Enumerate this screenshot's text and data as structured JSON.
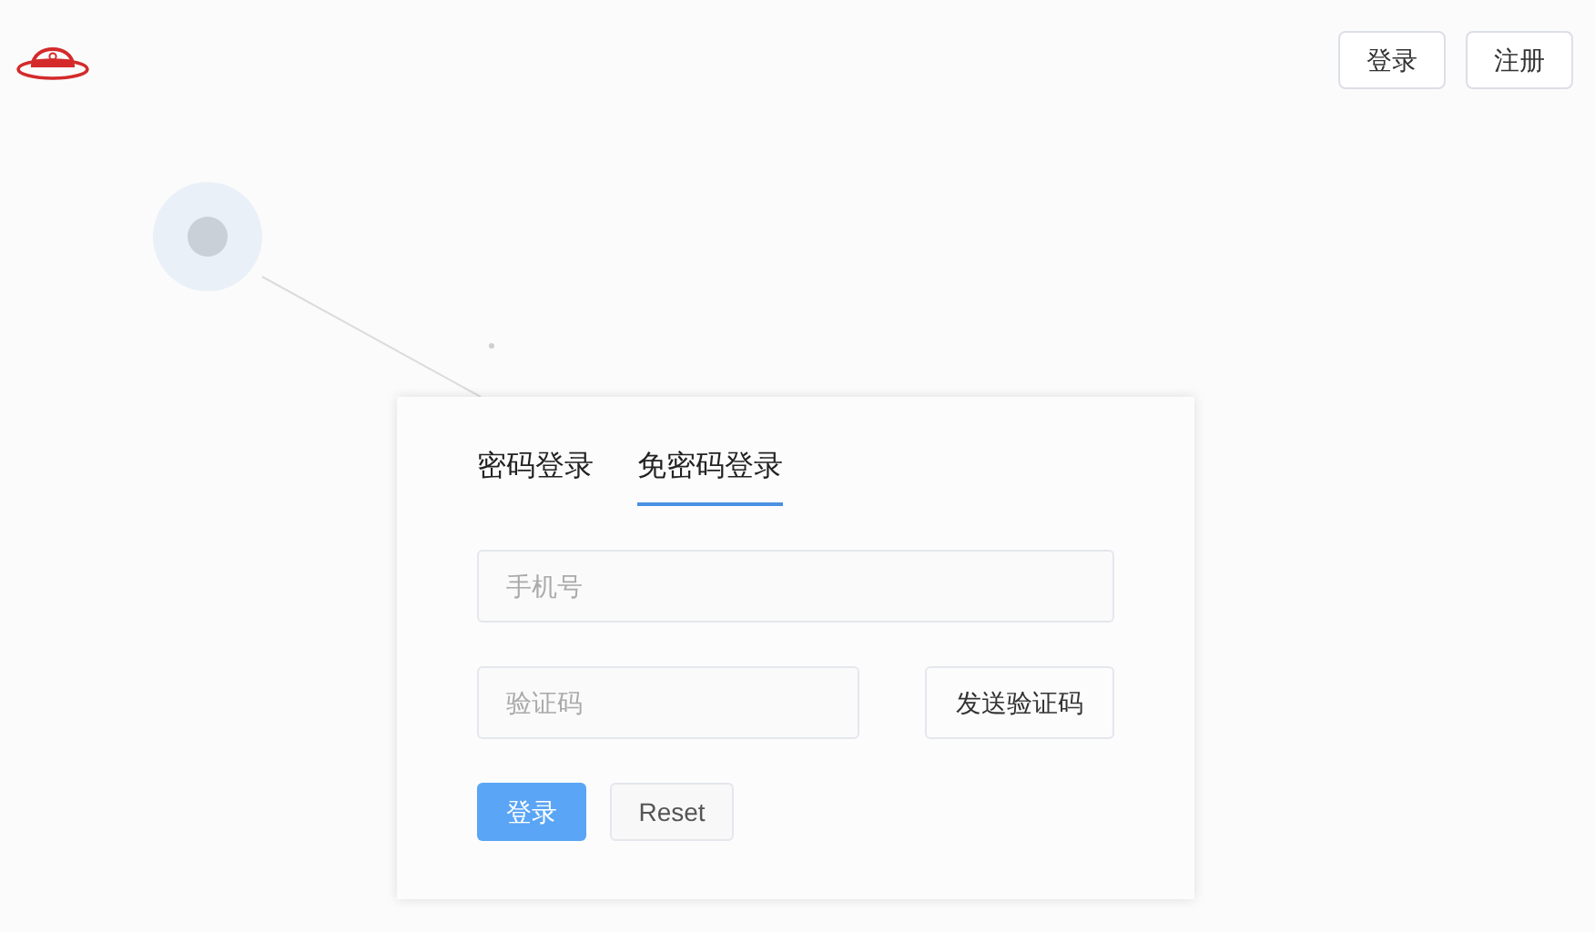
{
  "header": {
    "buttons": [
      "登录",
      "注册"
    ]
  },
  "login_card": {
    "tabs": [
      {
        "label": "密码登录",
        "selected": false
      },
      {
        "label": "免密码登录",
        "selected": true
      }
    ],
    "phone_field": {
      "placeholder": "手机号"
    },
    "code_field": {
      "placeholder": "验证码"
    },
    "send_code_button": "发送验证码",
    "submit_button": "登录",
    "reset_button": "Reset"
  }
}
